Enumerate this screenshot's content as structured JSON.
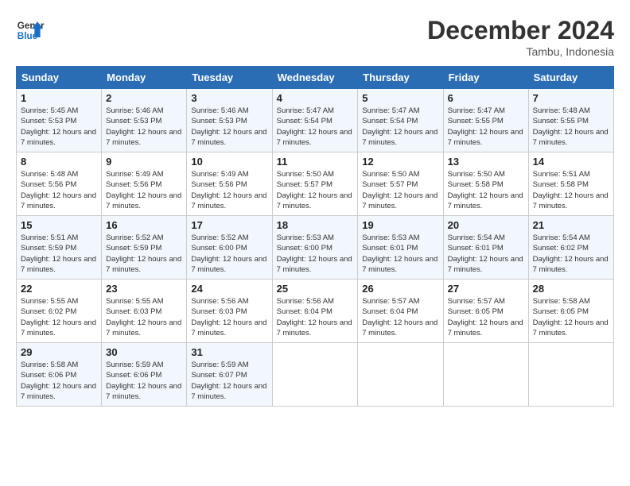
{
  "header": {
    "logo_line1": "General",
    "logo_line2": "Blue",
    "month_title": "December 2024",
    "location": "Tambu, Indonesia"
  },
  "weekdays": [
    "Sunday",
    "Monday",
    "Tuesday",
    "Wednesday",
    "Thursday",
    "Friday",
    "Saturday"
  ],
  "weeks": [
    [
      {
        "day": "1",
        "sunrise": "5:45 AM",
        "sunset": "5:53 PM",
        "daylight": "12 hours and 7 minutes."
      },
      {
        "day": "2",
        "sunrise": "5:46 AM",
        "sunset": "5:53 PM",
        "daylight": "12 hours and 7 minutes."
      },
      {
        "day": "3",
        "sunrise": "5:46 AM",
        "sunset": "5:53 PM",
        "daylight": "12 hours and 7 minutes."
      },
      {
        "day": "4",
        "sunrise": "5:47 AM",
        "sunset": "5:54 PM",
        "daylight": "12 hours and 7 minutes."
      },
      {
        "day": "5",
        "sunrise": "5:47 AM",
        "sunset": "5:54 PM",
        "daylight": "12 hours and 7 minutes."
      },
      {
        "day": "6",
        "sunrise": "5:47 AM",
        "sunset": "5:55 PM",
        "daylight": "12 hours and 7 minutes."
      },
      {
        "day": "7",
        "sunrise": "5:48 AM",
        "sunset": "5:55 PM",
        "daylight": "12 hours and 7 minutes."
      }
    ],
    [
      {
        "day": "8",
        "sunrise": "5:48 AM",
        "sunset": "5:56 PM",
        "daylight": "12 hours and 7 minutes."
      },
      {
        "day": "9",
        "sunrise": "5:49 AM",
        "sunset": "5:56 PM",
        "daylight": "12 hours and 7 minutes."
      },
      {
        "day": "10",
        "sunrise": "5:49 AM",
        "sunset": "5:56 PM",
        "daylight": "12 hours and 7 minutes."
      },
      {
        "day": "11",
        "sunrise": "5:50 AM",
        "sunset": "5:57 PM",
        "daylight": "12 hours and 7 minutes."
      },
      {
        "day": "12",
        "sunrise": "5:50 AM",
        "sunset": "5:57 PM",
        "daylight": "12 hours and 7 minutes."
      },
      {
        "day": "13",
        "sunrise": "5:50 AM",
        "sunset": "5:58 PM",
        "daylight": "12 hours and 7 minutes."
      },
      {
        "day": "14",
        "sunrise": "5:51 AM",
        "sunset": "5:58 PM",
        "daylight": "12 hours and 7 minutes."
      }
    ],
    [
      {
        "day": "15",
        "sunrise": "5:51 AM",
        "sunset": "5:59 PM",
        "daylight": "12 hours and 7 minutes."
      },
      {
        "day": "16",
        "sunrise": "5:52 AM",
        "sunset": "5:59 PM",
        "daylight": "12 hours and 7 minutes."
      },
      {
        "day": "17",
        "sunrise": "5:52 AM",
        "sunset": "6:00 PM",
        "daylight": "12 hours and 7 minutes."
      },
      {
        "day": "18",
        "sunrise": "5:53 AM",
        "sunset": "6:00 PM",
        "daylight": "12 hours and 7 minutes."
      },
      {
        "day": "19",
        "sunrise": "5:53 AM",
        "sunset": "6:01 PM",
        "daylight": "12 hours and 7 minutes."
      },
      {
        "day": "20",
        "sunrise": "5:54 AM",
        "sunset": "6:01 PM",
        "daylight": "12 hours and 7 minutes."
      },
      {
        "day": "21",
        "sunrise": "5:54 AM",
        "sunset": "6:02 PM",
        "daylight": "12 hours and 7 minutes."
      }
    ],
    [
      {
        "day": "22",
        "sunrise": "5:55 AM",
        "sunset": "6:02 PM",
        "daylight": "12 hours and 7 minutes."
      },
      {
        "day": "23",
        "sunrise": "5:55 AM",
        "sunset": "6:03 PM",
        "daylight": "12 hours and 7 minutes."
      },
      {
        "day": "24",
        "sunrise": "5:56 AM",
        "sunset": "6:03 PM",
        "daylight": "12 hours and 7 minutes."
      },
      {
        "day": "25",
        "sunrise": "5:56 AM",
        "sunset": "6:04 PM",
        "daylight": "12 hours and 7 minutes."
      },
      {
        "day": "26",
        "sunrise": "5:57 AM",
        "sunset": "6:04 PM",
        "daylight": "12 hours and 7 minutes."
      },
      {
        "day": "27",
        "sunrise": "5:57 AM",
        "sunset": "6:05 PM",
        "daylight": "12 hours and 7 minutes."
      },
      {
        "day": "28",
        "sunrise": "5:58 AM",
        "sunset": "6:05 PM",
        "daylight": "12 hours and 7 minutes."
      }
    ],
    [
      {
        "day": "29",
        "sunrise": "5:58 AM",
        "sunset": "6:06 PM",
        "daylight": "12 hours and 7 minutes."
      },
      {
        "day": "30",
        "sunrise": "5:59 AM",
        "sunset": "6:06 PM",
        "daylight": "12 hours and 7 minutes."
      },
      {
        "day": "31",
        "sunrise": "5:59 AM",
        "sunset": "6:07 PM",
        "daylight": "12 hours and 7 minutes."
      },
      null,
      null,
      null,
      null
    ]
  ]
}
